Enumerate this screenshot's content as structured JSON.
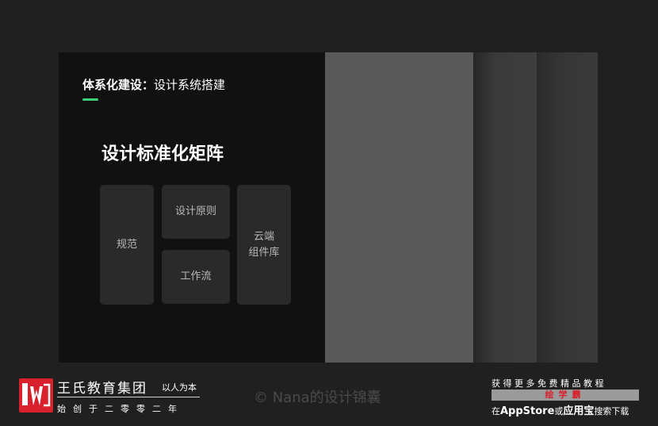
{
  "slide": {
    "title_bold": "体系化建设",
    "title_sep": "：",
    "title_rest": "设计系统搭建",
    "accent_color": "#3fd07a",
    "heading": "设计标准化矩阵",
    "cards": {
      "guidelines": "规范",
      "principles": "设计原则",
      "workflow": "工作流",
      "cloud_line1": "云端",
      "cloud_line2": "组件库"
    }
  },
  "footer": {
    "brand_name": "王氏教育集团",
    "slogan": "以人为本",
    "since": "始创于二零零二年",
    "watermark": "© Nana的设计锦囊",
    "promo_top": "获得更多免费精品教程",
    "promo_app": "绘学霸",
    "promo_bottom_prefix": "在",
    "promo_store1": "AppStore",
    "promo_or": "或",
    "promo_store2": "应用宝",
    "promo_suffix": "搜索下载",
    "brand_color": "#d8212c"
  }
}
